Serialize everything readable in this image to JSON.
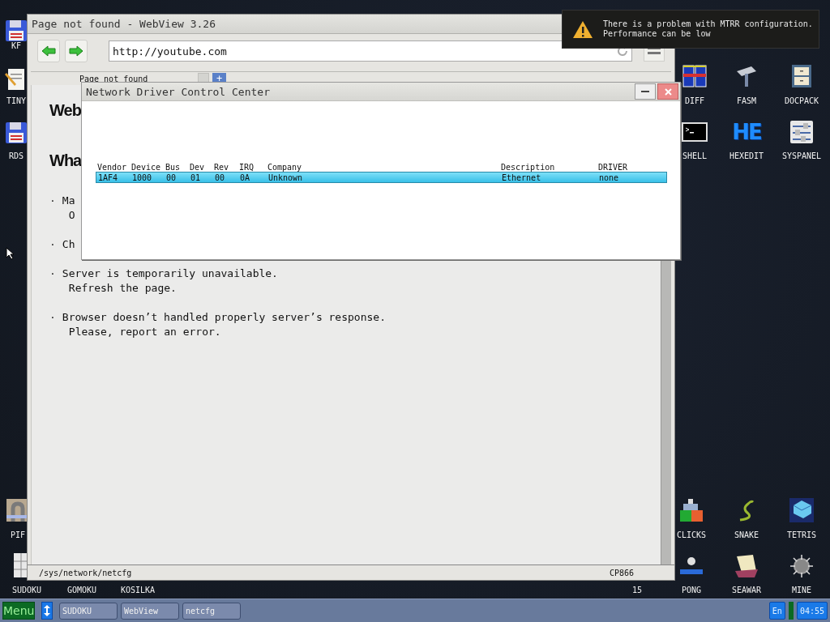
{
  "desktop": {
    "icons": [
      {
        "label": "KF",
        "kind": "floppy"
      },
      {
        "label": "TINY",
        "kind": "notepad"
      },
      {
        "label": "DIFF",
        "kind": "columns"
      },
      {
        "label": "FASM",
        "kind": "hammer"
      },
      {
        "label": "DOCPACK",
        "kind": "cabinet"
      },
      {
        "label": "RDS",
        "kind": "floppy"
      },
      {
        "label": "SHELL",
        "kind": "terminal"
      },
      {
        "label": "HEXEDIT",
        "kind": "logo",
        "glyph": "HE"
      },
      {
        "label": "SYSPANEL",
        "kind": "sliders"
      },
      {
        "label": "PIF",
        "kind": "pipe"
      },
      {
        "label": "CLICKS",
        "kind": "blocks"
      },
      {
        "label": "SNAKE",
        "kind": "snake"
      },
      {
        "label": "TETRIS",
        "kind": "cube"
      },
      {
        "label": "SUDOKU",
        "kind": "grid"
      },
      {
        "label": "GOMOKU"
      },
      {
        "label": "KOSILKA"
      },
      {
        "label": "15"
      },
      {
        "label": "PONG",
        "kind": "paddle"
      },
      {
        "label": "SEAWAR",
        "kind": "ship"
      },
      {
        "label": "MINE",
        "kind": "mine"
      }
    ]
  },
  "browser": {
    "title": "Page not found - WebView 3.26",
    "url": "http://youtube.com",
    "tabs": [
      {
        "label": "Page not found",
        "selected": true
      }
    ],
    "new_tab": "+",
    "page": {
      "headings": [
        "Web",
        "Wha"
      ],
      "items": [
        {
          "bullet": "·",
          "lines": [
            "Ma",
            "O"
          ]
        },
        {
          "bullet": "·",
          "lines": [
            "Ch"
          ]
        },
        {
          "bullet": "·",
          "lines": [
            "Server is temporarily unavailable.",
            "Refresh the page."
          ]
        },
        {
          "bullet": "·",
          "lines": [
            "Browser doesn’t handled properly server’s response.",
            "Please, report an error."
          ]
        }
      ]
    },
    "status_bar": {
      "path": "/sys/network/netcfg",
      "encoding": "CP866"
    }
  },
  "dialog": {
    "title": "Network Driver Control Center",
    "columns": [
      "Vendor",
      "Device",
      "Bus",
      "Dev",
      "Rev",
      "IRQ",
      "Company",
      "Description",
      "DRIVER"
    ],
    "rows": [
      {
        "cells": [
          "1AF4",
          "1000",
          "00",
          "01",
          "00",
          "0A",
          "Unknown",
          "Ethernet",
          "none"
        ],
        "selected": true
      }
    ]
  },
  "notification": {
    "lines": [
      "There is a problem with MTRR configuration.",
      "Performance can be low"
    ]
  },
  "taskbar": {
    "menu": "Menu",
    "tasks": [
      "SUDOKU",
      "WebView",
      "netcfg"
    ],
    "language": "En",
    "clock": "04:55"
  }
}
